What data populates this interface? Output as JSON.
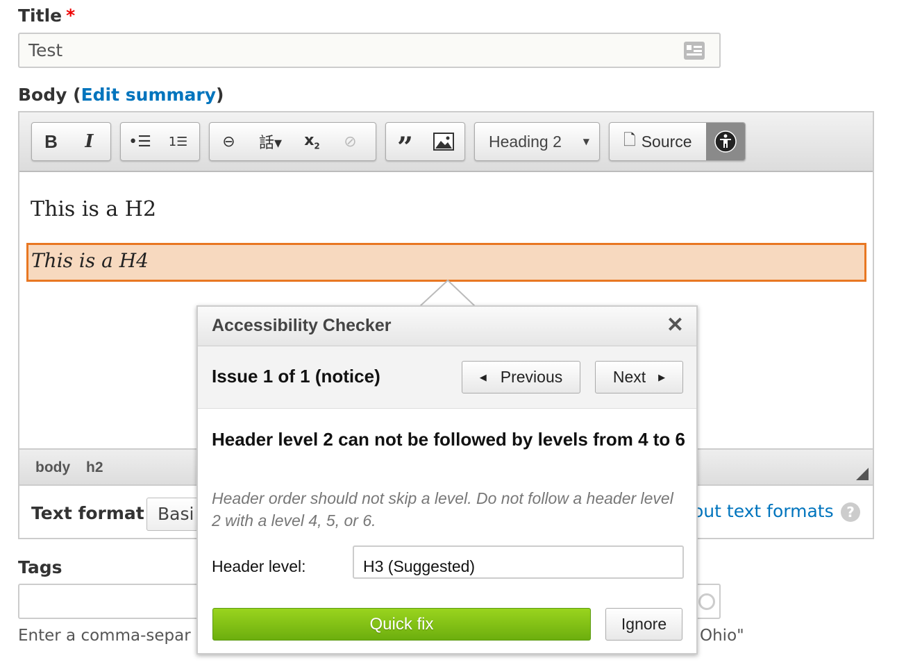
{
  "title_field": {
    "label": "Title",
    "required_mark": "*",
    "value": "Test",
    "icon": "contact-card-icon"
  },
  "body_field": {
    "label_prefix": "Body (",
    "link": "Edit summary",
    "label_suffix": ")"
  },
  "toolbar": {
    "bold": "B",
    "italic": "I",
    "heading_select": "Heading 2",
    "source": "Source"
  },
  "content": {
    "h2": "This is a H2",
    "h4": "This is a H4"
  },
  "path": [
    "body",
    "h2"
  ],
  "text_format": {
    "label": "Text format",
    "select_value": "Basi",
    "link": "out text formats"
  },
  "tags": {
    "label": "Tags",
    "help_left": "Enter a comma-separ",
    "help_right": "Ohio\""
  },
  "checker": {
    "title": "Accessibility Checker",
    "issue": "Issue 1 of 1 (notice)",
    "previous": "Previous",
    "next": "Next",
    "heading": "Header level 2 can not be followed by levels from 4 to 6",
    "description": "Header order should not skip a level. Do not follow a header level 2 with a level 4, 5, or 6.",
    "field_label": "Header level:",
    "field_value": "H3 (Suggested)",
    "quick_fix": "Quick fix",
    "ignore": "Ignore"
  },
  "colors": {
    "highlight_border": "#e87722",
    "highlight_bg": "#f7d9bf",
    "quick_fix": "#7cc21a",
    "link": "#0074bd"
  }
}
